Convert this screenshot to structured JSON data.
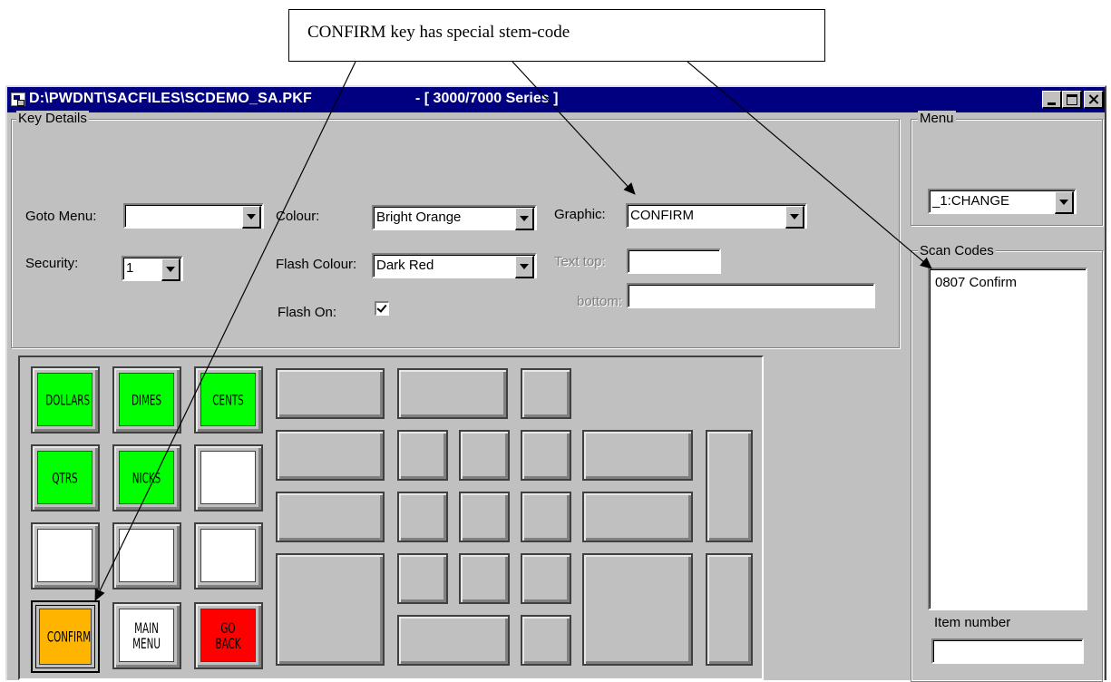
{
  "callout": {
    "text": "CONFIRM key has special stem-code"
  },
  "window": {
    "title_path": "D:\\PWDNT\\SACFILES\\SCDEMO_SA.PKF",
    "title_series": "-  [ 3000/7000 Series ]",
    "titlebar_color": "#000080"
  },
  "key_details": {
    "group_label": "Key Details",
    "goto_menu": {
      "label": "Goto Menu:",
      "value": ""
    },
    "security": {
      "label": "Security:",
      "value": "1"
    },
    "colour": {
      "label": "Colour:",
      "value": "Bright Orange"
    },
    "flash_colour": {
      "label": "Flash Colour:",
      "value": "Dark Red"
    },
    "flash_on": {
      "label": "Flash On:",
      "checked": true
    },
    "graphic": {
      "label": "Graphic:",
      "value": "CONFIRM"
    },
    "text_top": {
      "label": "Text top:",
      "value": ""
    },
    "text_bottom": {
      "label": "bottom:",
      "value": ""
    }
  },
  "menu_panel": {
    "group_label": "Menu",
    "value": "_1:CHANGE"
  },
  "scan_codes": {
    "group_label": "Scan Codes",
    "items": [
      "0807 Confirm"
    ]
  },
  "item_number": {
    "label": "Item number",
    "value": ""
  },
  "keys": {
    "dollars": {
      "label": "DOLLARS",
      "color": "#00ff00"
    },
    "dimes": {
      "label": "DIMES",
      "color": "#00ff00"
    },
    "cents": {
      "label": "CENTS",
      "color": "#00ff00"
    },
    "qtrs": {
      "label": "QTRS",
      "color": "#00ff00"
    },
    "nicks": {
      "label": "NICKS",
      "color": "#00ff00"
    },
    "confirm": {
      "label": "CONFIRM",
      "color": "#ffb400"
    },
    "main_menu": {
      "label": "MAIN\nMENU",
      "color": "#ffffff"
    },
    "go_back": {
      "label": "GO\nBACK",
      "color": "#ff0000"
    }
  }
}
